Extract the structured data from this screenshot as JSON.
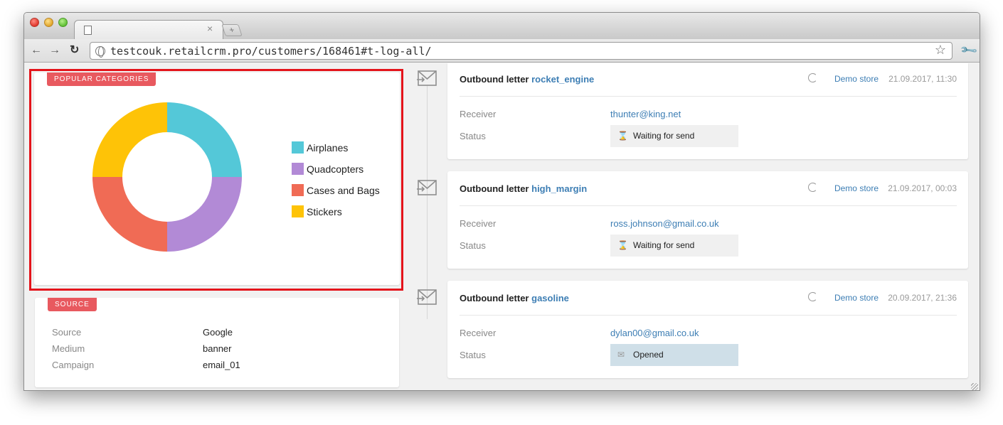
{
  "browser": {
    "url": "testcouk.retailcrm.pro/customers/168461#t-log-all/",
    "tab_close": "×",
    "new_tab": "+"
  },
  "popular_categories": {
    "title": "POPULAR CATEGORIES",
    "legend": [
      {
        "label": "Airplanes",
        "color": "#54c8d8"
      },
      {
        "label": "Quadcopters",
        "color": "#b28ad6"
      },
      {
        "label": "Cases and Bags",
        "color": "#f06b55"
      },
      {
        "label": "Stickers",
        "color": "#fec307"
      }
    ]
  },
  "chart_data": {
    "type": "pie",
    "variant": "donut",
    "categories": [
      "Airplanes",
      "Quadcopters",
      "Cases and Bags",
      "Stickers"
    ],
    "values": [
      25,
      25,
      25,
      25
    ],
    "colors": [
      "#54c8d8",
      "#b28ad6",
      "#f06b55",
      "#fec307"
    ],
    "legend_position": "right"
  },
  "source": {
    "title": "SOURCE",
    "rows": [
      {
        "key": "Source",
        "value": "Google"
      },
      {
        "key": "Medium",
        "value": "banner"
      },
      {
        "key": "Campaign",
        "value": "email_01"
      }
    ]
  },
  "letters": [
    {
      "prefix": "Outbound letter",
      "name": "rocket_engine",
      "store": "Demo store",
      "date": "21.09.2017, 11:30",
      "receiver_label": "Receiver",
      "receiver": "thunter@king.net",
      "status_label": "Status",
      "status": "Waiting for send",
      "status_icon": "hourglass-icon"
    },
    {
      "prefix": "Outbound letter",
      "name": "high_margin",
      "store": "Demo store",
      "date": "21.09.2017, 00:03",
      "receiver_label": "Receiver",
      "receiver": "ross.johnson@gmail.co.uk",
      "status_label": "Status",
      "status": "Waiting for send",
      "status_icon": "hourglass-icon"
    },
    {
      "prefix": "Outbound letter",
      "name": "gasoline",
      "store": "Demo store",
      "date": "20.09.2017, 21:36",
      "receiver_label": "Receiver",
      "receiver": "dylan00@gmail.co.uk",
      "status_label": "Status",
      "status": "Opened",
      "status_icon": "open-envelope-icon"
    }
  ]
}
